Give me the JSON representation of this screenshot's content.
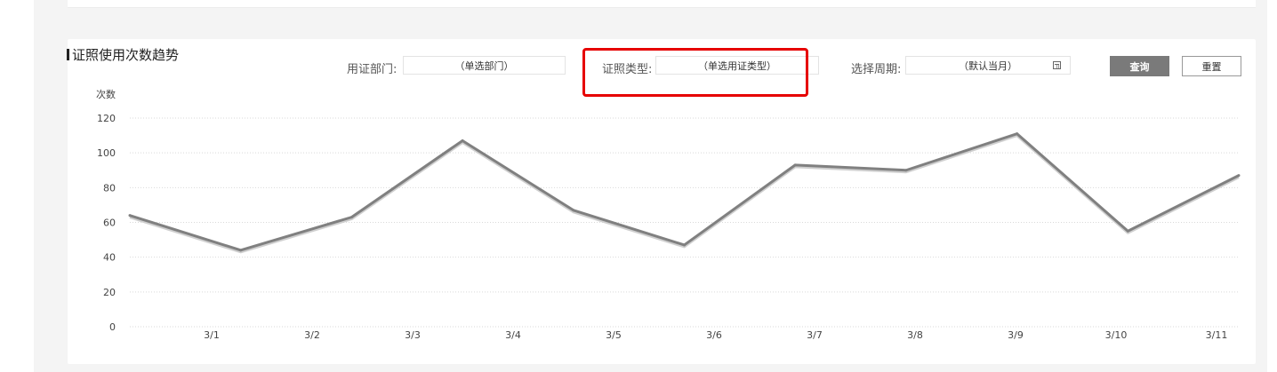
{
  "panel": {
    "title": "证照使用次数趋势"
  },
  "filters": {
    "dept_label": "用证部门:",
    "dept_placeholder": "（单选部门）",
    "type_label": "证照类型:",
    "type_placeholder": "（单选用证类型）",
    "period_label": "选择周期:",
    "period_placeholder": "（默认当月）"
  },
  "buttons": {
    "query": "查询",
    "reset": "重置"
  },
  "chart_data": {
    "type": "line",
    "ylabel": "次数",
    "xlabel": "",
    "ylim": [
      0,
      120
    ],
    "yticks": [
      0,
      20,
      40,
      60,
      80,
      100,
      120
    ],
    "categories": [
      "3/1",
      "3/2",
      "3/3",
      "3/4",
      "3/5",
      "3/6",
      "3/7",
      "3/8",
      "3/9",
      "3/10",
      "3/11"
    ],
    "series": [
      {
        "name": "",
        "color": "#808080",
        "values": [
          64,
          44,
          63,
          107,
          67,
          47,
          93,
          90,
          111,
          55,
          87
        ]
      }
    ],
    "grid": "horizontal-dotted",
    "legend": "none"
  }
}
